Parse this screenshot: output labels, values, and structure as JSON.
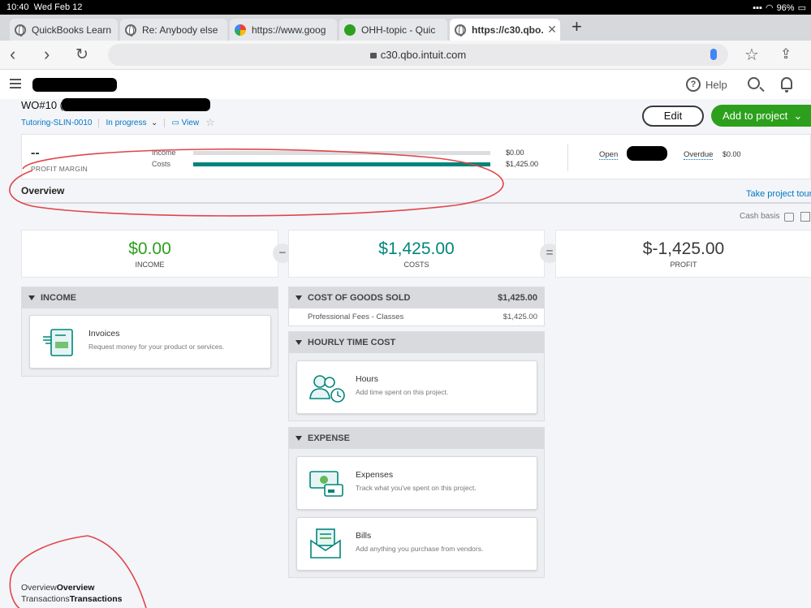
{
  "status_bar": {
    "time": "10:40",
    "date": "Wed Feb 12",
    "battery": "96%"
  },
  "browser": {
    "tabs": [
      {
        "title": "QuickBooks Learn",
        "icon": "globe-icon"
      },
      {
        "title": "Re: Anybody else",
        "icon": "globe-icon"
      },
      {
        "title": "https://www.goog",
        "icon": "google-icon"
      },
      {
        "title": "OHH-topic - Quic",
        "icon": "quickbooks-icon"
      },
      {
        "title": "https://c30.qbo.i",
        "icon": "globe-icon"
      }
    ],
    "url": "c30.qbo.intuit.com"
  },
  "header": {
    "help_label": "Help"
  },
  "project": {
    "title_prefix": "WO#10 (",
    "customer_ref": "Tutoring-SLIN-0010",
    "status": "In progress",
    "view_label": "View",
    "edit_label": "Edit",
    "add_label": "Add to project"
  },
  "summary": {
    "profit_margin_value": "--",
    "profit_margin_label": "PROFIT MARGIN",
    "income_label": "Income",
    "income_value": "$0.00",
    "costs_label": "Costs",
    "costs_value": "$1,425.00",
    "income_fill": 0,
    "costs_fill": 1,
    "open_label": "Open",
    "overdue_label": "Overdue",
    "overdue_value": "$0.00"
  },
  "overview": {
    "title": "Overview",
    "tour_link": "Take project tour",
    "cash_basis": "Cash basis"
  },
  "kpis": [
    {
      "amount": "$0.00",
      "label": "INCOME",
      "color": "#2ca01c"
    },
    {
      "amount": "$1,425.00",
      "label": "COSTS",
      "color": "#00857b"
    },
    {
      "amount": "$-1,425.00",
      "label": "PROFIT",
      "color": "#393a3d"
    }
  ],
  "operators": [
    "−",
    "="
  ],
  "income_panel": {
    "title": "INCOME",
    "card": {
      "title": "Invoices",
      "desc": "Request money for your product or services."
    }
  },
  "cogs_panel": {
    "title": "COST OF GOODS SOLD",
    "total": "$1,425.00",
    "rows": [
      {
        "label": "Professional Fees - Classes",
        "amount": "$1,425.00"
      }
    ]
  },
  "hourly_panel": {
    "title": "HOURLY TIME COST",
    "card": {
      "title": "Hours",
      "desc": "Add time spent on this project."
    }
  },
  "expense_panel": {
    "title": "EXPENSE",
    "cards": [
      {
        "title": "Expenses",
        "desc": "Track what you've spent on this project."
      },
      {
        "title": "Bills",
        "desc": "Add anything you purchase from vendors."
      }
    ]
  },
  "bottom_links": [
    {
      "plain": "Overview",
      "bold": "Overview"
    },
    {
      "plain": "Transactions",
      "bold": "Transactions"
    }
  ],
  "colors": {
    "accent_green": "#2ca01c",
    "teal": "#00857b",
    "link_blue": "#0077c5",
    "annotation_red": "#e0454a"
  }
}
